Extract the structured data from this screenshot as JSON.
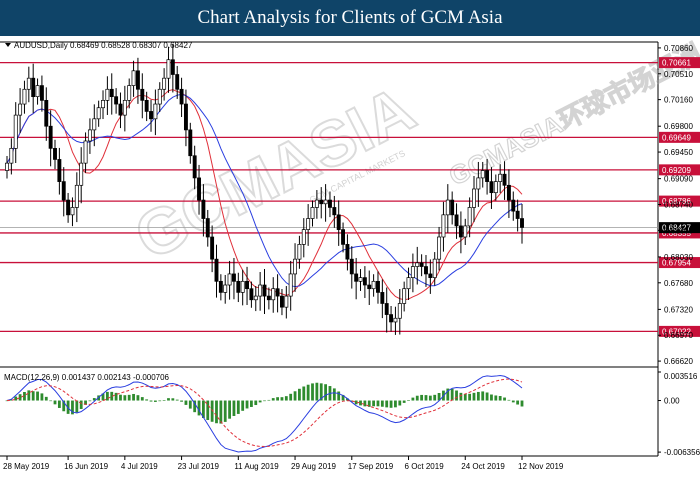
{
  "header": {
    "title": "Chart Analysis for Clients of GCM Asia"
  },
  "watermark": {
    "text": "GCMASIA",
    "sub": "GCM CAPITAL MARKETS",
    "cn": "GCMASIA环球市场亚洲"
  },
  "chart_data": {
    "type": "candlestick",
    "symbol_line": "AUDUSD,Daily  0.68469 0.68528 0.68307 0.68427",
    "price_axis": {
      "ylim": [
        0.6654,
        0.7094
      ],
      "ticks": [
        "0.70860",
        "0.70510",
        "0.70160",
        "0.69800",
        "0.69450",
        "0.69090",
        "0.68740",
        "0.68390",
        "0.68030",
        "0.67680",
        "0.67320",
        "0.66970",
        "0.66620"
      ]
    },
    "levels": [
      {
        "label": "0.70661",
        "value": 0.70661
      },
      {
        "label": "0.69649",
        "value": 0.69649
      },
      {
        "label": "0.69209",
        "value": 0.69209
      },
      {
        "label": "0.68786",
        "value": 0.68786
      },
      {
        "label": "0.68355",
        "value": 0.68355
      },
      {
        "label": "0.67954",
        "value": 0.67954
      },
      {
        "label": "0.67022",
        "value": 0.67022
      }
    ],
    "current_price": {
      "label": "0.68427",
      "value": 0.68427
    },
    "date_labels": [
      {
        "label": "28 May 2019",
        "bar": 0
      },
      {
        "label": "16 Jun 2019",
        "bar": 14
      },
      {
        "label": "4 Jul 2019",
        "bar": 27
      },
      {
        "label": "23 Jul 2019",
        "bar": 40
      },
      {
        "label": "11 Aug 2019",
        "bar": 53
      },
      {
        "label": "29 Aug 2019",
        "bar": 66
      },
      {
        "label": "17 Sep 2019",
        "bar": 79
      },
      {
        "label": "6 Oct 2019",
        "bar": 92
      },
      {
        "label": "24 Oct 2019",
        "bar": 105
      },
      {
        "label": "12 Nov 2019",
        "bar": 118
      }
    ],
    "closes": [
      0.693,
      0.695,
      0.6995,
      0.701,
      0.703,
      0.7045,
      0.702,
      0.7035,
      0.7015,
      0.698,
      0.695,
      0.6935,
      0.6905,
      0.688,
      0.686,
      0.687,
      0.69,
      0.693,
      0.696,
      0.6975,
      0.699,
      0.7005,
      0.7015,
      0.703,
      0.702,
      0.701,
      0.6995,
      0.7015,
      0.7035,
      0.7055,
      0.703,
      0.7015,
      0.7,
      0.699,
      0.701,
      0.703,
      0.7045,
      0.707,
      0.705,
      0.703,
      0.701,
      0.6975,
      0.694,
      0.691,
      0.688,
      0.6855,
      0.683,
      0.68,
      0.677,
      0.6755,
      0.6765,
      0.678,
      0.677,
      0.6755,
      0.677,
      0.676,
      0.6745,
      0.675,
      0.6765,
      0.675,
      0.6745,
      0.676,
      0.675,
      0.6735,
      0.675,
      0.678,
      0.68,
      0.682,
      0.684,
      0.6855,
      0.687,
      0.688,
      0.6875,
      0.688,
      0.687,
      0.686,
      0.684,
      0.682,
      0.68,
      0.678,
      0.677,
      0.6775,
      0.6765,
      0.676,
      0.677,
      0.6755,
      0.674,
      0.6725,
      0.6715,
      0.672,
      0.674,
      0.676,
      0.6775,
      0.679,
      0.6795,
      0.679,
      0.678,
      0.6775,
      0.68,
      0.683,
      0.686,
      0.688,
      0.686,
      0.6845,
      0.683,
      0.6845,
      0.687,
      0.6895,
      0.691,
      0.692,
      0.6905,
      0.689,
      0.6905,
      0.6915,
      0.69,
      0.688,
      0.6865,
      0.6855,
      0.6843
    ],
    "ma_period_short": 10,
    "ma_period_long": 20,
    "macd": {
      "label": "MACD(12,26,9)  0.001437  0.002143  -0.000706",
      "ylim": [
        -0.00659,
        0.003516
      ],
      "ticks": [
        "0.003516",
        "0.00",
        "-0.006356"
      ]
    }
  }
}
